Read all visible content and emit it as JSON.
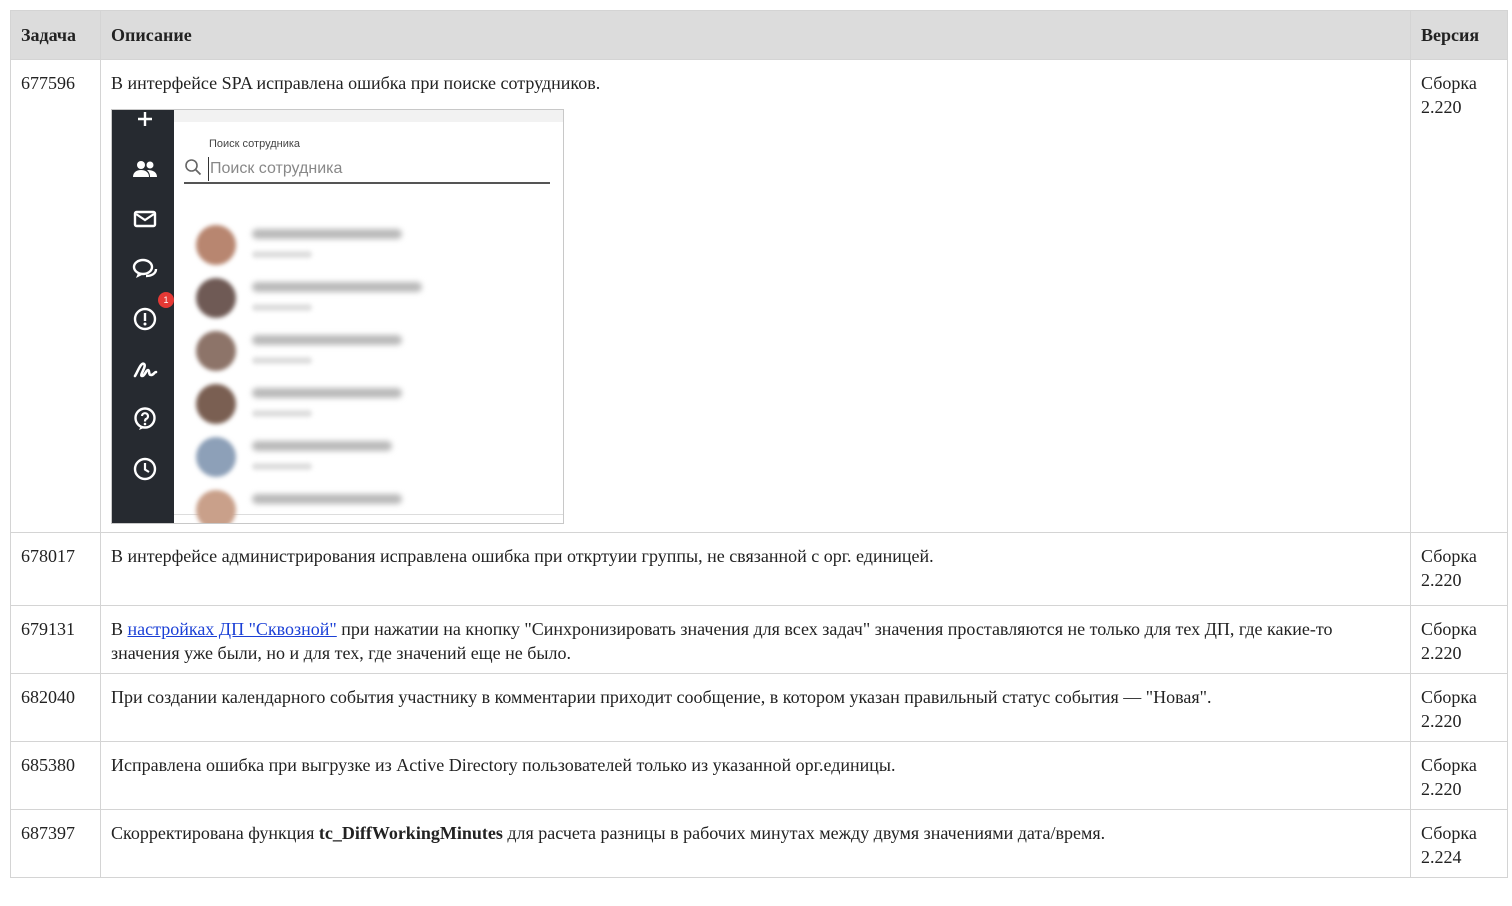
{
  "headers": {
    "task": "Задача",
    "description": "Описание",
    "version": "Версия"
  },
  "rows": [
    {
      "task": "677596",
      "text": "В интерфейсе SPA исправлена ошибка при поиске сотрудников.",
      "version_line1": "Сборка",
      "version_line2": "2.220"
    },
    {
      "task": "678017",
      "text": "В интерфейсе администрирования исправлена ошибка при откртуии группы, не связанной с орг. единицей.",
      "version_line1": "Сборка",
      "version_line2": "2.220"
    },
    {
      "task": "679131",
      "text_before": "В ",
      "link": "настройках ДП \"Сквозной\"",
      "text_after": " при нажатии на кнопку \"Синхронизировать значения для всех задач\" значения проставляются не только для тех ДП, где какие-то значения уже были, но и для тех, где значений еще не было.",
      "version_line1": "Сборка",
      "version_line2": "2.220"
    },
    {
      "task": "682040",
      "text": "При создании календарного события участнику в комментарии приходит сообщение, в котором указан правильный статус события — \"Новая\".",
      "version_line1": "Сборка",
      "version_line2": "2.220"
    },
    {
      "task": "685380",
      "text": "Исправлена ошибка при выгрузке из Active Directory пользователей только из указанной орг.единицы.",
      "version_line1": "Сборка",
      "version_line2": "2.220"
    },
    {
      "task": "687397",
      "text_before": "Скорректирована функция ",
      "bold": "tc_DiffWorkingMinutes",
      "text_after": " для расчета разницы в рабочих минутах между двумя значениями дата/время.",
      "version_line1": "Сборка",
      "version_line2": "2.224"
    }
  ],
  "screenshot": {
    "search_label": "Поиск сотрудника",
    "search_placeholder": "Поиск сотрудника",
    "badge": "1",
    "rail_icons": [
      "plus-icon",
      "people-icon",
      "mail-icon",
      "chat-icon",
      "alert-icon",
      "signature-icon",
      "help-icon",
      "clock-icon"
    ],
    "avatar_colors": [
      "#b88670",
      "#6f5a55",
      "#8d7469",
      "#7a5f52",
      "#8da0b8",
      "#c9a08a"
    ]
  }
}
